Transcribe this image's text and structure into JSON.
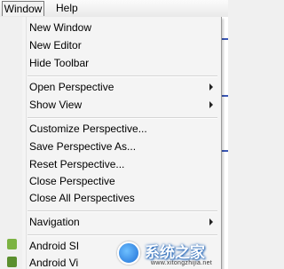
{
  "menubar": {
    "window": "Window",
    "help": "Help"
  },
  "menu": {
    "group1": [
      "New Window",
      "New Editor",
      "Hide Toolbar"
    ],
    "open_perspective": "Open Perspective",
    "show_view": "Show View",
    "group3": [
      "Customize Perspective...",
      "Save Perspective As...",
      "Reset Perspective...",
      "Close Perspective",
      "Close All Perspectives"
    ],
    "navigation": "Navigation",
    "android1": "Android SI",
    "android2": "Android Vi"
  },
  "watermark": {
    "title": "系统之家",
    "url": "www.xitongzhijia.net"
  }
}
